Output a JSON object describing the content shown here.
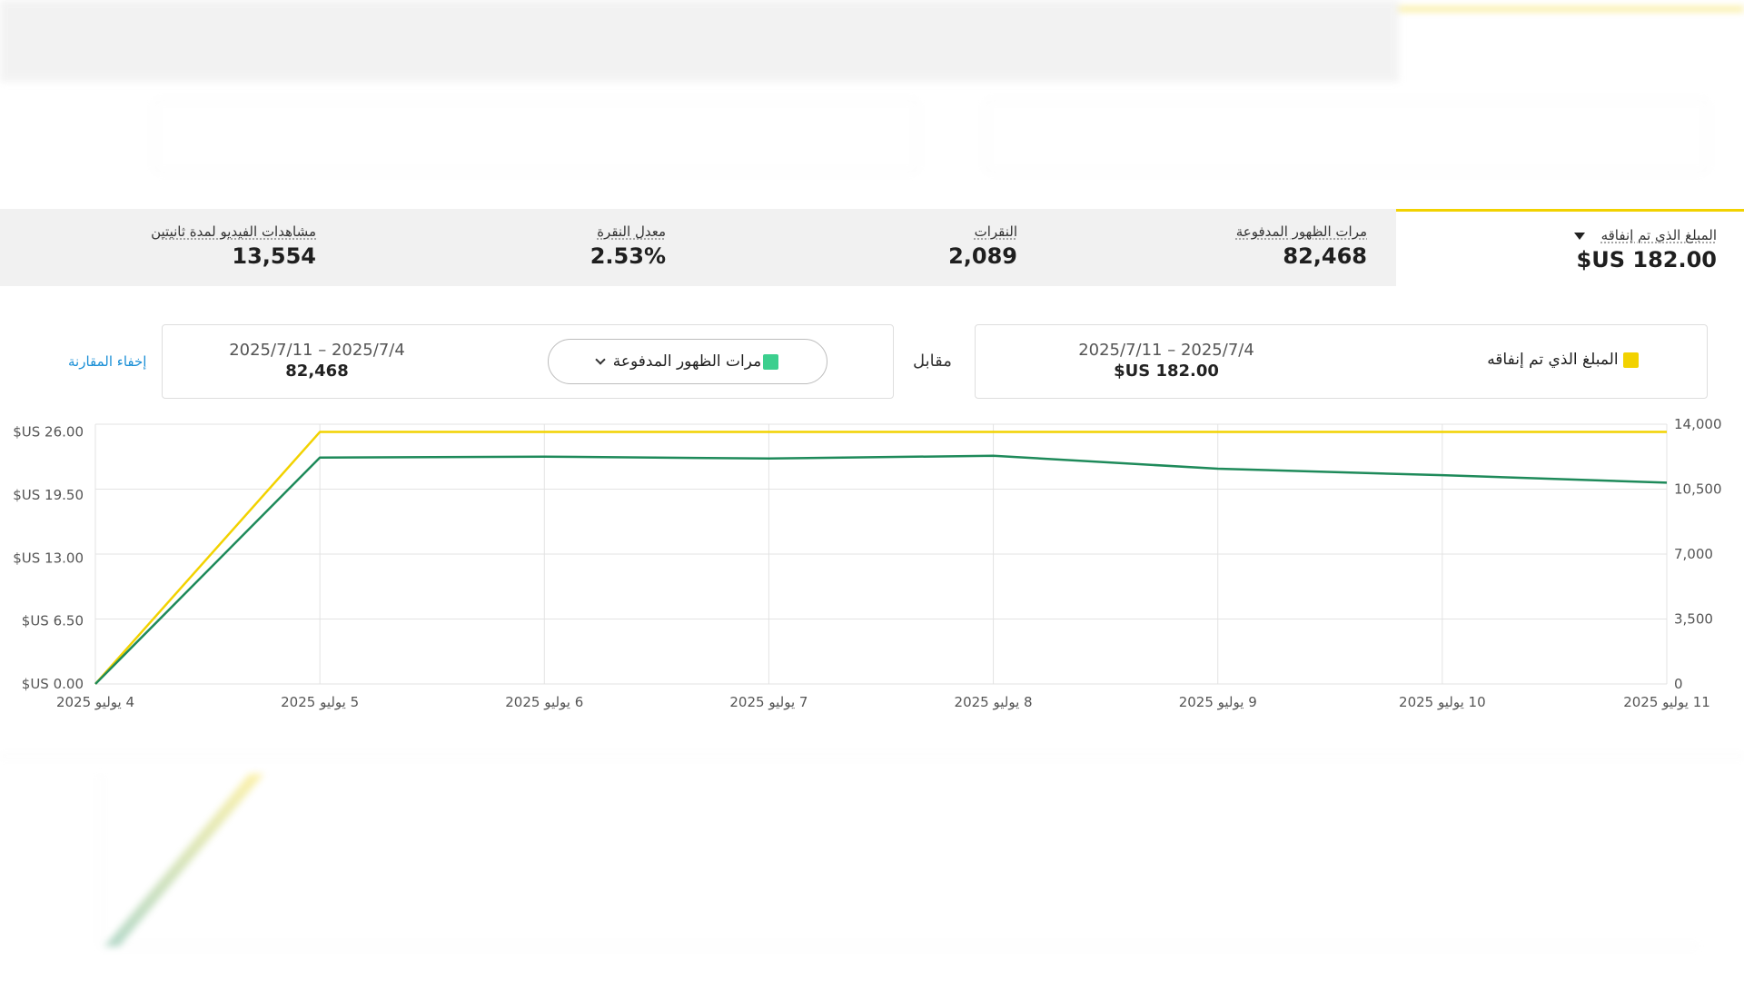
{
  "metrics": {
    "items": [
      {
        "label": "المبلغ الذي تم إنفاقه",
        "value": "$US 182.00",
        "selected": true
      },
      {
        "label": "مرات الظهور المدفوعة",
        "value": "82,468"
      },
      {
        "label": "النقرات",
        "value": "2,089"
      },
      {
        "label": "معدل النقرة",
        "value": "2.53%"
      },
      {
        "label": "مشاهدات الفيديو لمدة ثانيتين",
        "value": "13,554"
      }
    ]
  },
  "comparison": {
    "primary": {
      "metric_label": "المبلغ الذي تم إنفاقه",
      "date_range": "2025/7/4 – 2025/7/11",
      "value": "$US 182.00",
      "color": "#f2d200"
    },
    "vs_label": "مقابل",
    "secondary": {
      "metric_label": "مرات الظهور المدفوعة",
      "date_range": "2025/7/4 – 2025/7/11",
      "value": "82,468",
      "color": "#3ccf8e"
    },
    "hide_label": "إخفاء المقارنة"
  },
  "chart_data": {
    "type": "line",
    "x": [
      "4 يوليو 2025",
      "5 يوليو 2025",
      "6 يوليو 2025",
      "7 يوليو 2025",
      "8 يوليو 2025",
      "9 يوليو 2025",
      "10 يوليو 2025",
      "11 يوليو 2025"
    ],
    "series": [
      {
        "name": "المبلغ الذي تم إنفاقه",
        "axis": "left",
        "color": "#f2d200",
        "values": [
          0,
          26,
          26,
          26,
          26,
          26,
          26,
          26
        ]
      },
      {
        "name": "مرات الظهور المدفوعة",
        "axis": "right",
        "color": "#1e8a5a",
        "values": [
          0,
          12200,
          12250,
          12150,
          12300,
          11600,
          11250,
          10850
        ]
      }
    ],
    "y_left": {
      "ticks": [
        0,
        6.5,
        13,
        19.5,
        26
      ],
      "tick_labels": [
        "$US 0.00",
        "$US 6.50",
        "$US 13.00",
        "$US 19.50",
        "$US 26.00"
      ],
      "lim": [
        0,
        26.8
      ]
    },
    "y_right": {
      "ticks": [
        0,
        3500,
        7000,
        10500,
        14000
      ],
      "tick_labels": [
        "0",
        "3,500",
        "7,000",
        "10,500",
        "14,000"
      ],
      "lim": [
        0,
        14000
      ]
    },
    "grid": true
  }
}
